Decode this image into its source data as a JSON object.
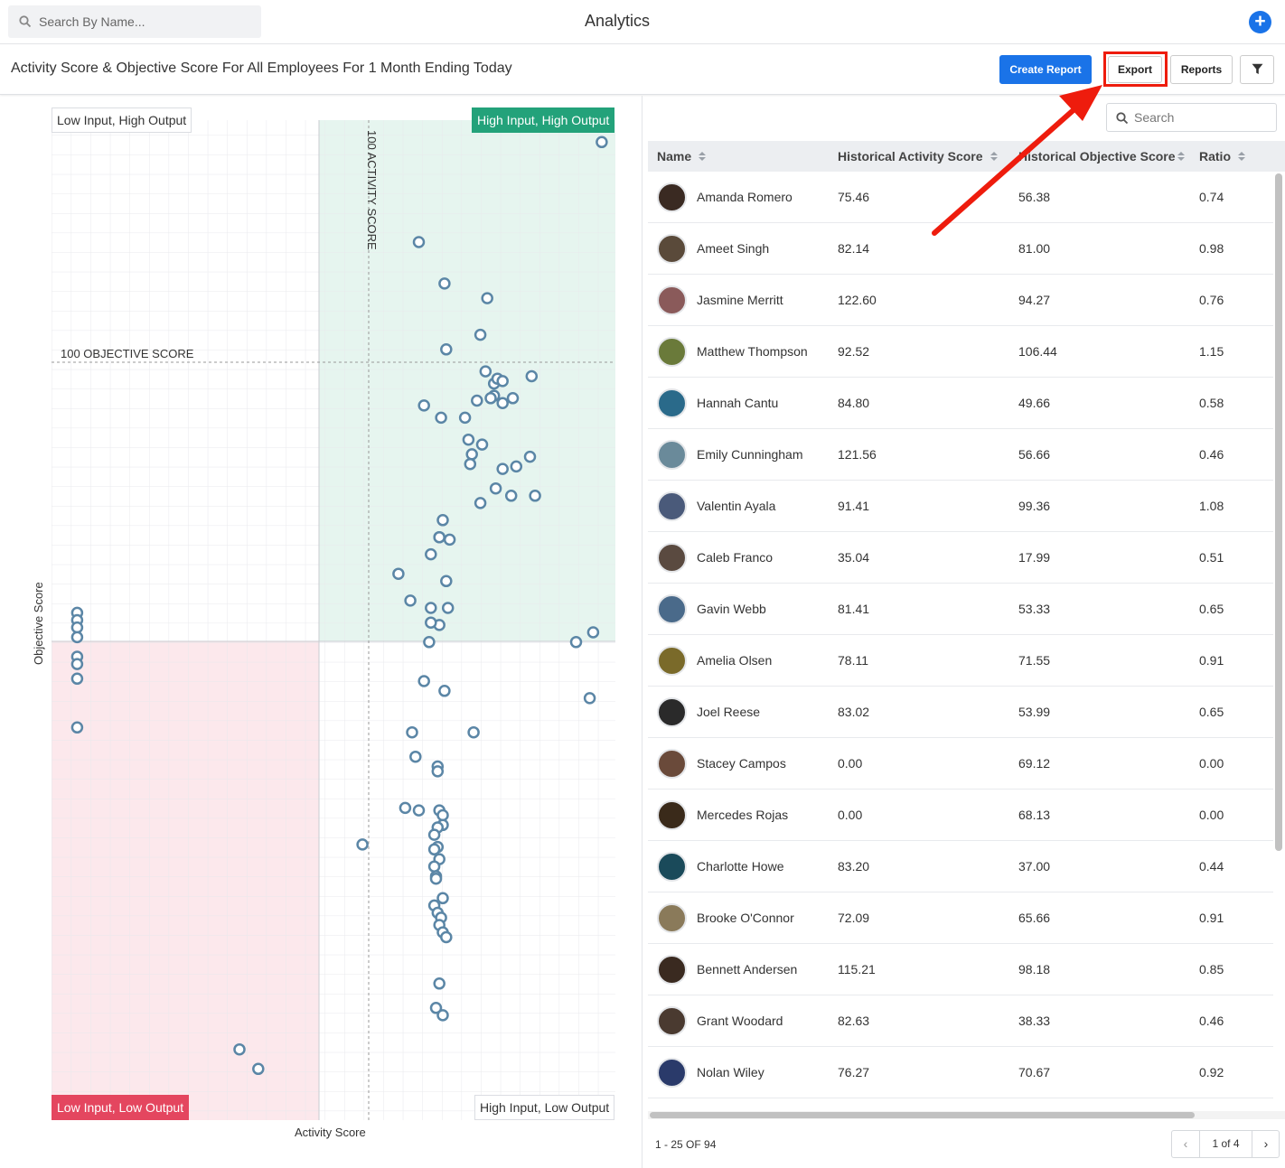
{
  "topbar": {
    "search_placeholder": "Search By Name...",
    "app_title": "Analytics",
    "add_label": "+"
  },
  "header": {
    "title": "Activity Score & Objective Score For All Employees For 1 Month Ending Today",
    "create_report": "Create Report",
    "export": "Export",
    "reports": "Reports"
  },
  "chart": {
    "quadrants": {
      "top_left": "Low Input, High Output",
      "top_right": "High Input, High Output",
      "bottom_left": "Low Input, Low Output",
      "bottom_right": "High Input, Low Output"
    },
    "objective_line_label": "100 OBJECTIVE SCORE",
    "activity_line_label": "100 ACTIVITY SCORE",
    "xlabel": "Activity Score",
    "ylabel": "Objective Score",
    "colors": {
      "high_high": "#e6f5ef",
      "low_low": "#fce8ec",
      "marker": "#5b86a6"
    }
  },
  "chart_data": {
    "type": "scatter",
    "xlabel": "Activity Score",
    "ylabel": "Objective Score",
    "xlim": [
      -87,
      243
    ],
    "ylim": [
      -270,
      140
    ],
    "reference_lines": {
      "x": 100,
      "y": 100
    },
    "x": [
      235,
      128,
      143,
      168,
      164,
      144,
      172,
      167,
      174,
      194,
      177,
      172,
      162,
      170,
      177,
      183,
      131,
      141,
      155,
      157,
      159,
      165,
      193,
      177,
      185,
      158,
      196,
      182,
      173,
      164,
      142,
      140,
      135,
      146,
      140,
      116,
      144,
      123,
      145,
      135,
      140,
      135,
      230,
      220,
      134,
      228,
      160,
      124,
      126,
      143,
      131,
      95,
      120,
      128,
      -72,
      -72,
      -72,
      -72,
      -72,
      -72,
      -72,
      -72,
      139,
      139,
      140,
      142,
      142,
      139,
      137,
      139,
      137,
      140,
      137,
      138,
      138,
      142,
      137,
      139,
      141,
      140,
      142,
      144,
      140,
      138,
      142,
      34,
      23
    ],
    "y": [
      131,
      90,
      73,
      67,
      52,
      46,
      32,
      37,
      34,
      35,
      33,
      27,
      25,
      26,
      24,
      26,
      23,
      18,
      18,
      9,
      3,
      7,
      2,
      -3,
      -2,
      -1,
      -14,
      -14,
      -11,
      -17,
      -24,
      -31,
      -38,
      -32,
      -31,
      -46,
      -49,
      -57,
      -60,
      -60,
      -67,
      -66,
      -70,
      -74,
      -74,
      -97,
      -111,
      -111,
      -121,
      -94,
      -90,
      -157,
      -142,
      -143,
      -62,
      -65,
      -68,
      -72,
      -80,
      -83,
      -89,
      -109,
      -125,
      -127,
      -143,
      -145,
      -149,
      -150,
      -153,
      -158,
      -159,
      -163,
      -166,
      -170,
      -171,
      -179,
      -182,
      -185,
      -187,
      -190,
      -193,
      -195,
      -214,
      -224,
      -227,
      -249,
      -241
    ]
  },
  "table": {
    "search_placeholder": "Search",
    "headers": [
      "Name",
      "Historical Activity Score",
      "Historical Objective Score",
      "Ratio"
    ],
    "rows": [
      {
        "name": "Amanda Romero",
        "activity": "75.46",
        "objective": "56.38",
        "ratio": "0.74"
      },
      {
        "name": "Ameet Singh",
        "activity": "82.14",
        "objective": "81.00",
        "ratio": "0.98"
      },
      {
        "name": "Jasmine Merritt",
        "activity": "122.60",
        "objective": "94.27",
        "ratio": "0.76"
      },
      {
        "name": "Matthew Thompson",
        "activity": "92.52",
        "objective": "106.44",
        "ratio": "1.15"
      },
      {
        "name": "Hannah Cantu",
        "activity": "84.80",
        "objective": "49.66",
        "ratio": "0.58"
      },
      {
        "name": "Emily Cunningham",
        "activity": "121.56",
        "objective": "56.66",
        "ratio": "0.46"
      },
      {
        "name": "Valentin Ayala",
        "activity": "91.41",
        "objective": "99.36",
        "ratio": "1.08"
      },
      {
        "name": "Caleb Franco",
        "activity": "35.04",
        "objective": "17.99",
        "ratio": "0.51"
      },
      {
        "name": "Gavin Webb",
        "activity": "81.41",
        "objective": "53.33",
        "ratio": "0.65"
      },
      {
        "name": "Amelia Olsen",
        "activity": "78.11",
        "objective": "71.55",
        "ratio": "0.91"
      },
      {
        "name": "Joel Reese",
        "activity": "83.02",
        "objective": "53.99",
        "ratio": "0.65"
      },
      {
        "name": "Stacey Campos",
        "activity": "0.00",
        "objective": "69.12",
        "ratio": "0.00"
      },
      {
        "name": "Mercedes Rojas",
        "activity": "0.00",
        "objective": "68.13",
        "ratio": "0.00"
      },
      {
        "name": "Charlotte Howe",
        "activity": "83.20",
        "objective": "37.00",
        "ratio": "0.44"
      },
      {
        "name": "Brooke O'Connor",
        "activity": "72.09",
        "objective": "65.66",
        "ratio": "0.91"
      },
      {
        "name": "Bennett Andersen",
        "activity": "115.21",
        "objective": "98.18",
        "ratio": "0.85"
      },
      {
        "name": "Grant Woodard",
        "activity": "82.63",
        "objective": "38.33",
        "ratio": "0.46"
      },
      {
        "name": "Nolan Wiley",
        "activity": "76.27",
        "objective": "70.67",
        "ratio": "0.92"
      }
    ],
    "avatar_colors": [
      "#3a2a22",
      "#5a4a3a",
      "#8a5a5a",
      "#6a7a3a",
      "#2a6a8a",
      "#6a8a9a",
      "#4a5a7a",
      "#5a4a40",
      "#4a6a8a",
      "#7a6a2a",
      "#2a2a2a",
      "#6a4a3a",
      "#3a2a1a",
      "#1a4a5a",
      "#8a7a5a",
      "#3a2a20",
      "#4a3a30",
      "#2a3a6a"
    ],
    "pager_range": "1 - 25 OF 94",
    "pager_page": "1 of 4",
    "pager_prev": "‹",
    "pager_next": "›"
  }
}
